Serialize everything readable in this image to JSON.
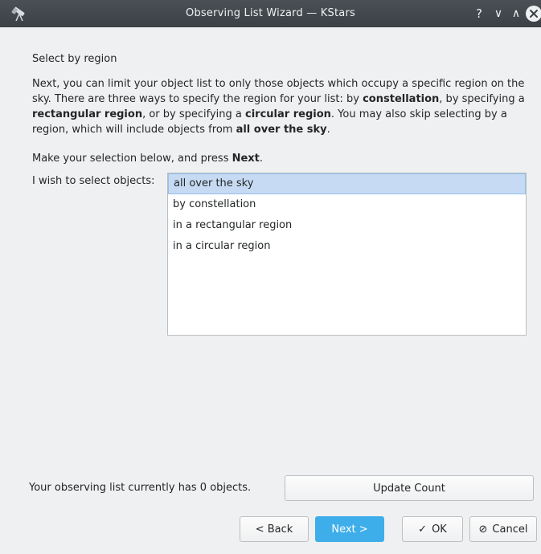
{
  "window": {
    "title": "Observing List Wizard — KStars",
    "help_glyph": "?",
    "minimize_glyph": "∨",
    "maximize_glyph": "∧",
    "close_glyph": "✕"
  },
  "page": {
    "heading": "Select by region",
    "para_1": "Next, you can limit your object list to only those objects which occupy a specific region on the sky. There are three ways to specify the region for your list: by ",
    "para_b1": "constellation",
    "para_2": ", by specifying a ",
    "para_b2": "rectangular region",
    "para_3": ", or by specifying a ",
    "para_b3": "circular region",
    "para_4": ". You may also skip selecting by a region, which will include objects from ",
    "para_b4": "all over the sky",
    "para_5": ".",
    "instr_1": "Make your selection below, and press ",
    "instr_b": "Next",
    "instr_2": ".",
    "select_label": "I wish to select objects:",
    "options": [
      "all over the sky",
      "by constellation",
      "in a rectangular region",
      "in a circular region"
    ],
    "selected_option": "all over the sky",
    "count_label": "Your observing list currently has 0 objects."
  },
  "buttons": {
    "update_count": "Update Count",
    "back": "< Back",
    "next": "Next >",
    "ok_glyph": "✓",
    "ok": "OK",
    "cancel_glyph": "⊘",
    "cancel": "Cancel"
  },
  "colors": {
    "accent": "#3daee9",
    "selection": "#c6dbf3",
    "titlebar": "#41464b"
  },
  "icons": {
    "app": "kstars-telescope-icon",
    "close": "close-icon",
    "ok": "check-icon",
    "cancel": "cancel-icon"
  }
}
